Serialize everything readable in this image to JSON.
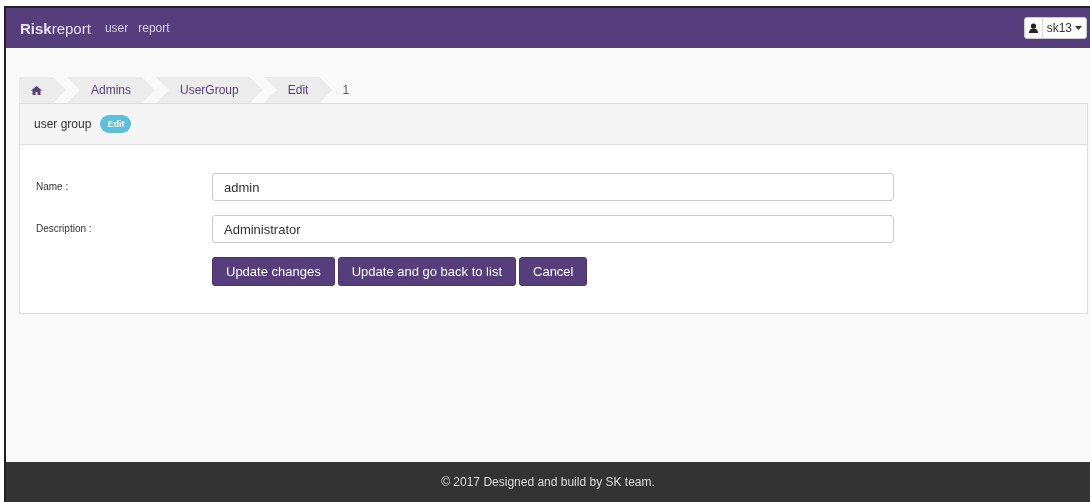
{
  "navbar": {
    "brand": "**Risk**report",
    "links": [
      "user",
      "report"
    ],
    "user_menu": {
      "label": "sk13"
    }
  },
  "breadcrumb": {
    "items": [
      "Admins",
      "UserGroup",
      "Edit"
    ],
    "current": "1"
  },
  "panel": {
    "title": "user group",
    "badge": "Edit",
    "fields": [
      {
        "label": "Name :",
        "value": "admin"
      },
      {
        "label": "Description :",
        "value": "Administrator"
      }
    ],
    "buttons": [
      "Update changes",
      "Update and go back to list",
      "Cancel"
    ]
  },
  "footer": {
    "text": "© 2017 Designed and build by SK team."
  }
}
